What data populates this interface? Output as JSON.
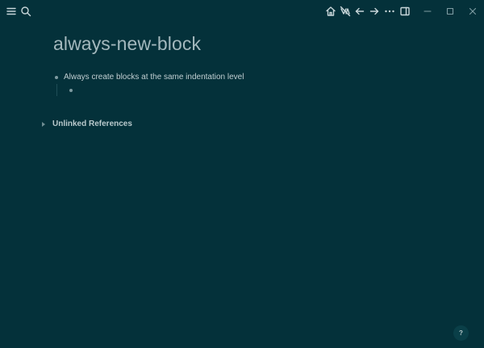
{
  "topbar": {
    "left_icons": [
      "menu-icon",
      "search-icon"
    ],
    "right_icons": [
      "home-icon",
      "no-sync-icon",
      "back-arrow-icon",
      "forward-arrow-icon",
      "more-icon",
      "sidebar-toggle-icon"
    ],
    "window_controls": [
      "minimize-icon",
      "maximize-icon",
      "close-icon"
    ]
  },
  "page": {
    "title": "always-new-block",
    "blocks": [
      {
        "text": "Always create blocks at the same indentation level",
        "children": [
          {
            "text": ""
          }
        ]
      }
    ]
  },
  "references": {
    "unlinked_label": "Unlinked References"
  },
  "help": {
    "label": "?"
  },
  "colors": {
    "background": "#04313a",
    "title": "#a3b8bd",
    "text": "#c0ced1",
    "bullet": "#7d9aa0"
  }
}
